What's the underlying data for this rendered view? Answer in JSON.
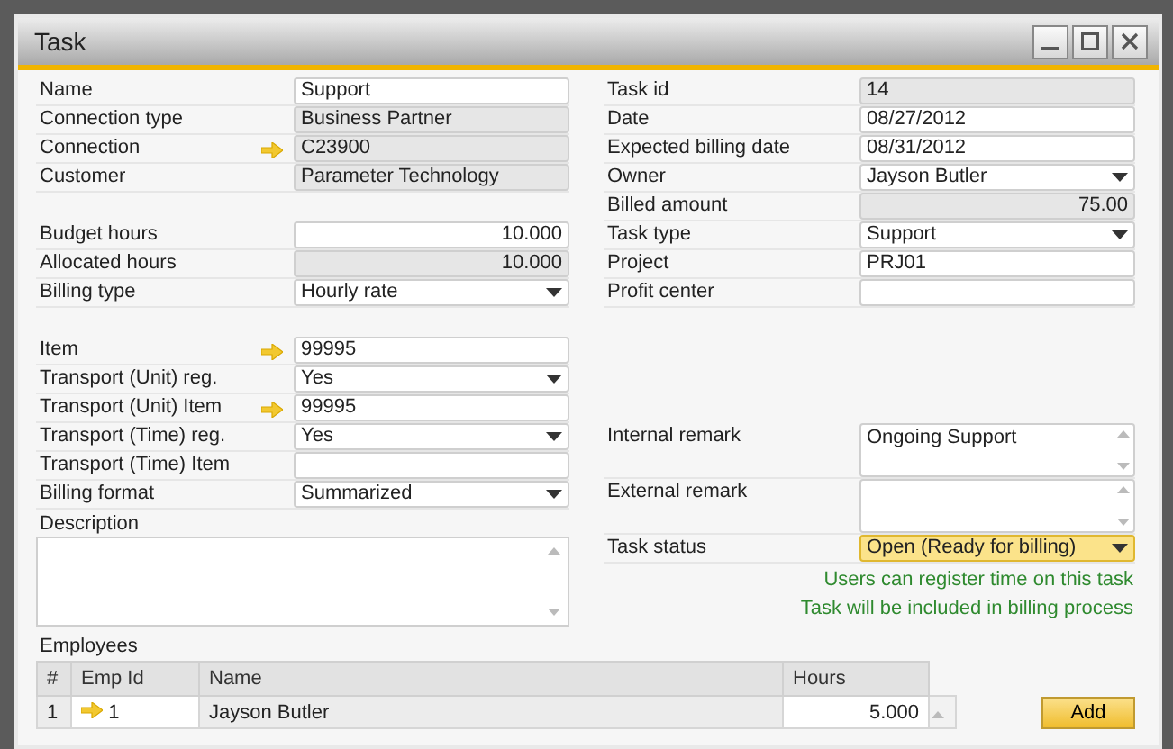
{
  "window": {
    "title": "Task"
  },
  "left_fields": [
    {
      "kind": "input",
      "label": "Name",
      "value": "Support",
      "link": false
    },
    {
      "kind": "readonly",
      "label": "Connection type",
      "value": "Business Partner",
      "link": false
    },
    {
      "kind": "readonly",
      "label": "Connection",
      "value": "C23900",
      "link": true
    },
    {
      "kind": "readonly",
      "label": "Customer",
      "value": "Parameter Technology",
      "link": false
    },
    {
      "kind": "gap"
    },
    {
      "kind": "input-number",
      "label": "Budget hours",
      "value": "10.000",
      "link": false
    },
    {
      "kind": "readonly-number",
      "label": "Allocated hours",
      "value": "10.000",
      "link": false
    },
    {
      "kind": "dropdown",
      "label": "Billing type",
      "value": "Hourly rate",
      "link": false
    },
    {
      "kind": "gap"
    },
    {
      "kind": "input",
      "label": "Item",
      "value": "99995",
      "link": true
    },
    {
      "kind": "dropdown",
      "label": "Transport (Unit) reg.",
      "value": "Yes",
      "link": false
    },
    {
      "kind": "input",
      "label": "Transport (Unit) Item",
      "value": "99995",
      "link": true
    },
    {
      "kind": "dropdown",
      "label": "Transport (Time) reg.",
      "value": "Yes",
      "link": false
    },
    {
      "kind": "input",
      "label": "Transport (Time) Item",
      "link": false
    },
    {
      "kind": "dropdown",
      "label": "Billing format",
      "value": "Summarized",
      "link": false
    }
  ],
  "description": {
    "label": "Description"
  },
  "right_fields": [
    {
      "kind": "readonly",
      "label": "Task id",
      "value": "14",
      "link": false
    },
    {
      "kind": "input",
      "label": "Date",
      "value": "08/27/2012",
      "link": false
    },
    {
      "kind": "input",
      "label": "Expected billing date",
      "value": "08/31/2012",
      "link": false
    },
    {
      "kind": "dropdown",
      "label": "Owner",
      "value": "Jayson Butler",
      "link": false
    },
    {
      "kind": "readonly-number",
      "label": "Billed amount",
      "value": "75.00",
      "link": false
    },
    {
      "kind": "dropdown",
      "label": "Task type",
      "value": "Support",
      "link": false
    },
    {
      "kind": "input",
      "label": "Project",
      "value": "PRJ01",
      "link": false
    },
    {
      "kind": "input",
      "label": "Profit center",
      "link": false
    },
    {
      "kind": "gap"
    },
    {
      "kind": "gap"
    },
    {
      "kind": "gap"
    },
    {
      "kind": "gap"
    },
    {
      "kind": "textarea",
      "label": "Internal remark",
      "value": "Ongoing Support",
      "link": false
    },
    {
      "kind": "textarea",
      "label": "External remark",
      "link": false
    },
    {
      "kind": "dropdown",
      "label": "Task status",
      "value": "Open (Ready for billing)",
      "link": false,
      "highlighted": true
    }
  ],
  "status_notes": [
    "Users can register time on this task",
    "Task will be included in billing process"
  ],
  "employees": {
    "label": "Employees",
    "columns": [
      "#",
      "Emp Id",
      "Name",
      "Hours"
    ],
    "rows": [
      {
        "num": "1",
        "emp_id": "1",
        "name": "Jayson Butler",
        "hours": "5.000"
      }
    ]
  },
  "buttons": [
    "Add"
  ]
}
